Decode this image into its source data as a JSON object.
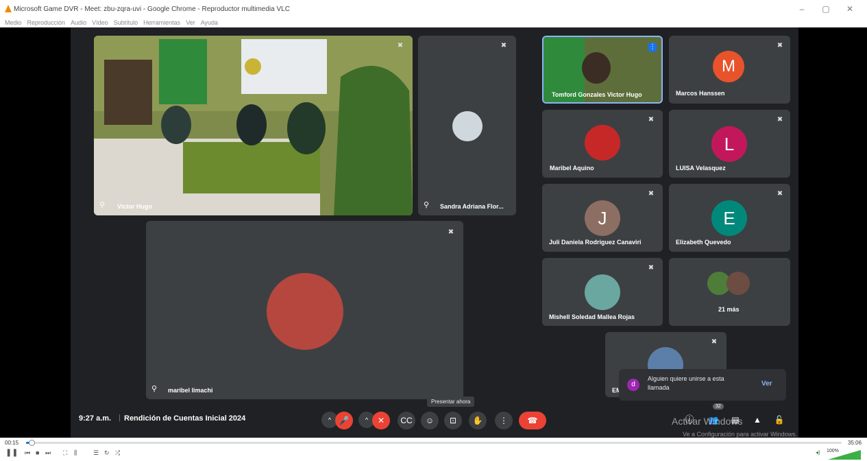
{
  "window": {
    "title": "Microsoft Game DVR - Meet: zbu-zqra-uvi - Google Chrome - Reproductor multimedia VLC"
  },
  "menu": [
    "Medio",
    "Reproducción",
    "Audio",
    "Vídeo",
    "Subtítulo",
    "Herramientas",
    "Ver",
    "Ayuda"
  ],
  "tiles": {
    "main_room": {
      "name": "Victor Hugo"
    },
    "sandra": {
      "name": "Sandra Adriana Flor..."
    },
    "maribel_limachi": {
      "name": "maribel limachi"
    },
    "victor": {
      "name": "Tomford Gonzales Victor Hugo"
    },
    "marcos": {
      "name": "Marcos Hanssen",
      "initial": "M"
    },
    "maribel_aquino": {
      "name": "Maribel Aquino"
    },
    "luisa": {
      "name": "LUISA Velasquez",
      "initial": "L"
    },
    "juli": {
      "name": "Juli Daniela Rodriguez Canaviri",
      "initial": "J"
    },
    "elizabeth": {
      "name": "Elizabeth Quevedo",
      "initial": "E"
    },
    "mishell": {
      "name": "Mishell Soledad Mallea Rojas"
    },
    "more": {
      "label": "21 más"
    },
    "em": {
      "name": "EM"
    }
  },
  "notification": {
    "text": "Alguien quiere unirse a esta llamada",
    "action": "Ver",
    "avatar": "d"
  },
  "meeting": {
    "time": "9:27 a.m.",
    "title": "Rendición de Cuentas Inicial 2024",
    "participants_count": "32"
  },
  "tooltip": "Presentar ahora",
  "activation": {
    "title": "Activar Windows",
    "subtitle": "Ve a Configuración para activar Windows."
  },
  "player": {
    "elapsed": "00:15",
    "total": "35:06",
    "volume": "100%",
    "progress": 0.007
  },
  "colors": {
    "meet_bg": "#202124",
    "tile_bg": "#3c4043",
    "end_call": "#ea4335",
    "accent": "#8ab4f8"
  }
}
